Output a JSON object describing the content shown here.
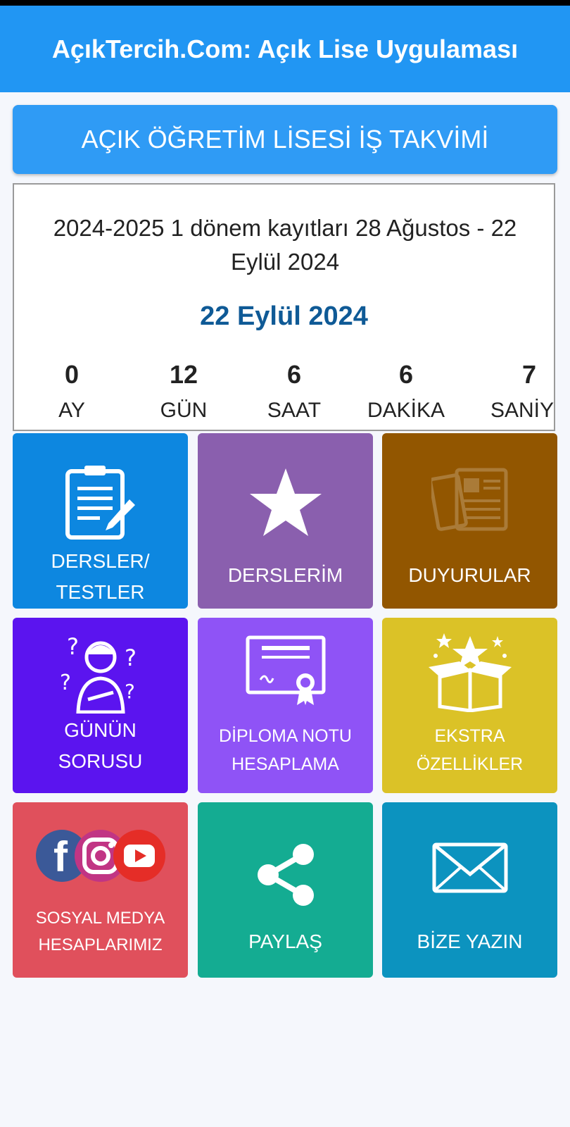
{
  "app": {
    "title": "AçıkTercih.Com: Açık Lise Uygulaması"
  },
  "calendar_button": {
    "label": "AÇIK ÖĞRETİM LİSESİ İŞ TAKVİMİ"
  },
  "event": {
    "description": "2024-2025 1 dönem kayıtları 28 Ağustos - 22 Eylül 2024",
    "date": "22 Eylül 2024"
  },
  "countdown": [
    {
      "value": "0",
      "unit": "AY"
    },
    {
      "value": "12",
      "unit": "GÜN"
    },
    {
      "value": "6",
      "unit": "SAAT"
    },
    {
      "value": "6",
      "unit": "DAKİKA"
    },
    {
      "value": "7",
      "unit": "SANİYE"
    }
  ],
  "tiles": [
    {
      "label1": "DERSLER/",
      "label2": "TESTLER",
      "icon": "clipboard-pencil-icon",
      "color": "#0d87e0"
    },
    {
      "label": "DERSLERİM",
      "icon": "star-icon",
      "color": "#8a5fae"
    },
    {
      "label": "DUYURULAR",
      "icon": "newspaper-icon",
      "color": "#925600"
    },
    {
      "label1": "GÜNÜN",
      "label2": "SORUSU",
      "icon": "thinking-person-icon",
      "color": "#5b14ef"
    },
    {
      "label1": "DİPLOMA NOTU",
      "label2": "HESAPLAMA",
      "icon": "diploma-icon",
      "color": "#8f53f6"
    },
    {
      "label1": "EKSTRA",
      "label2": "ÖZELLİKLER",
      "icon": "gift-box-icon",
      "color": "#dbc227"
    },
    {
      "label1": "SOSYAL MEDYA",
      "label2": "HESAPLARIMIZ",
      "icon": "social-media-icon",
      "color": "#e0505c"
    },
    {
      "label": "PAYLAŞ",
      "icon": "share-icon",
      "color": "#14ac92"
    },
    {
      "label": "BİZE YAZIN",
      "icon": "envelope-icon",
      "color": "#0c93bf"
    }
  ]
}
